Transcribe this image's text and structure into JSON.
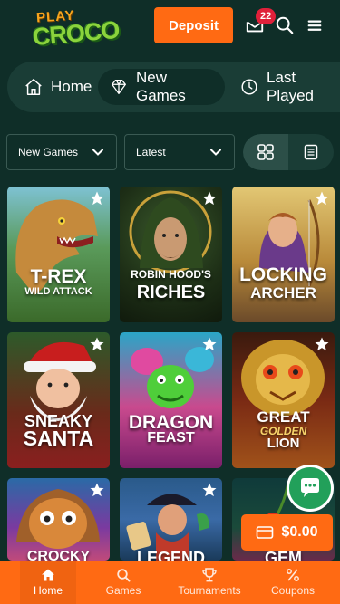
{
  "header": {
    "logo_top": "PLAY",
    "logo_bottom": "CROCO",
    "deposit_label": "Deposit",
    "mail_count": "22"
  },
  "nav": {
    "items": [
      {
        "label": "Home"
      },
      {
        "label": "New Games"
      },
      {
        "label": "Last Played"
      }
    ]
  },
  "filters": {
    "category_value": "New Games",
    "sort_value": "Latest"
  },
  "games": [
    {
      "line1": "T-REX",
      "line2": "WILD ATTACK"
    },
    {
      "line1": "ROBIN HOOD'S",
      "line2": "RICHES"
    },
    {
      "line1": "LOCKING",
      "line2": "ARCHER"
    },
    {
      "line1": "SNEAKY",
      "line2": "SANTA"
    },
    {
      "line1": "DRAGON",
      "line2": "FEAST"
    },
    {
      "line1": "GREAT",
      "line2": "GOLDEN",
      "line3": "LION"
    },
    {
      "line1": "CROCKY"
    },
    {
      "line1": "LEGEND"
    },
    {
      "line1": "GEM"
    }
  ],
  "balance": "$0.00",
  "bottom_nav": {
    "home": "Home",
    "games": "Games",
    "tournaments": "Tournaments",
    "coupons": "Coupons"
  },
  "colors": {
    "background": "#0f2e28",
    "accent": "#ff6a13",
    "badge": "#e0203a",
    "chat": "#22a05a"
  }
}
